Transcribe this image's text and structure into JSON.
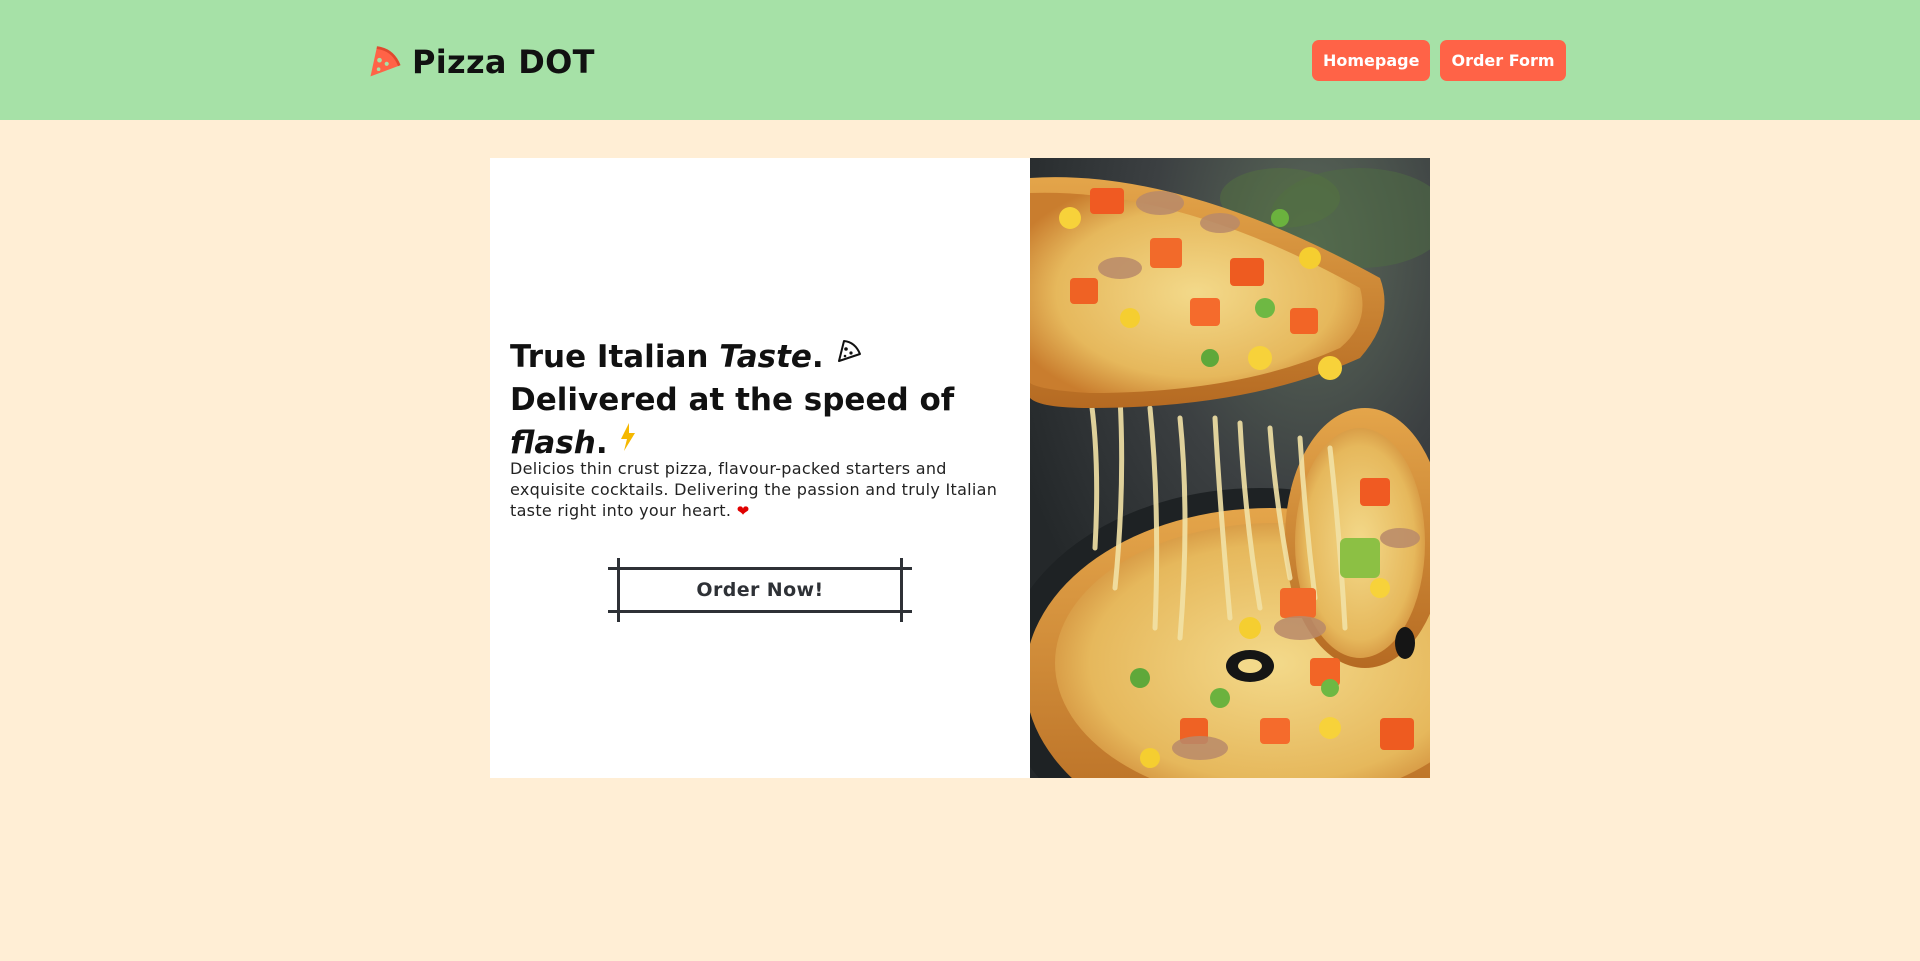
{
  "header": {
    "brand_name": "Pizza DOT",
    "brand_icon": "pizza-slice-icon",
    "nav": [
      {
        "label": "Homepage"
      },
      {
        "label": "Order Form"
      }
    ]
  },
  "hero": {
    "title_part1": "True Italian ",
    "title_em1": "Taste",
    "title_part2": ". ",
    "title_part3": " Delivered at the speed of ",
    "title_em2": "flash",
    "title_part4": ". ",
    "title_icons": [
      "pizza-slice-icon",
      "lightning-bolt-icon"
    ],
    "description": "Delicios thin crust pizza, flavour-packed starters and exquisite cocktails. Delivering the passion and truly Italian taste right into your heart. ",
    "heart_glyph": "❤",
    "cta_label": "Order Now!",
    "image_subject": "pizza-slice-with-melted-cheese-image"
  },
  "colors": {
    "navbar_bg": "#A6E1A7",
    "page_bg": "#FFEED5",
    "accent": "#FF6347",
    "bolt": "#F5B800",
    "heart": "#E00000",
    "text_dark": "#2E3136"
  }
}
